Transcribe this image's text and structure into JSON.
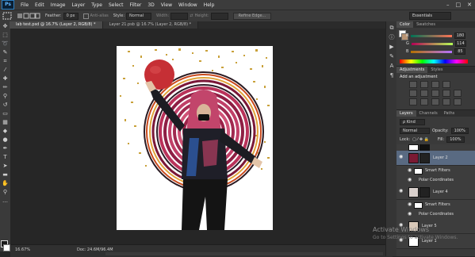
{
  "app": {
    "logo": "Ps"
  },
  "menu": [
    "File",
    "Edit",
    "Image",
    "Layer",
    "Type",
    "Select",
    "Filter",
    "3D",
    "View",
    "Window",
    "Help"
  ],
  "window_controls": [
    "–",
    "□",
    "✕"
  ],
  "options": {
    "feather_label": "Feather:",
    "feather_value": "0 px",
    "antialias_label": "Anti-alias",
    "style_label": "Style:",
    "style_value": "Normal",
    "width_label": "Width:",
    "height_label": "Height:",
    "refine_edge": "Refine Edge...",
    "workspace": "Essentials"
  },
  "tabs": [
    {
      "label": "lab test.psd @ 16.7% (Layer 2, RGB/8) *"
    },
    {
      "label": "Layer 21.psb @ 16.7% (Layer 2, RGB/8) *"
    }
  ],
  "status": {
    "zoom": "16.67%",
    "doc": "Doc: 24.6M/96.4M"
  },
  "color_panel": {
    "tab_color": "Color",
    "tab_swatches": "Swatches",
    "r_label": "R",
    "r_value": "180",
    "g_label": "G",
    "g_value": "114",
    "b_label": "B",
    "b_value": "85"
  },
  "adjustments": {
    "tab_adjustments": "Adjustments",
    "tab_styles": "Styles",
    "title": "Add an adjustment"
  },
  "layers": {
    "tab_layers": "Layers",
    "tab_channels": "Channels",
    "tab_paths": "Paths",
    "kind_label": "ρ Kind",
    "blend": "Normal",
    "opacity_label": "Opacity:",
    "opacity_value": "100%",
    "lock_label": "Lock:",
    "fill_label": "Fill:",
    "fill_value": "100%",
    "items": [
      {
        "name": "Layer 2"
      },
      {
        "name": "Smart Filters"
      },
      {
        "name": "Polar Coordinates"
      },
      {
        "name": "Layer 4"
      },
      {
        "name": "Smart Filters"
      },
      {
        "name": "Polar Coordinates"
      },
      {
        "name": "Layer 5"
      },
      {
        "name": "Layer 1"
      }
    ]
  },
  "watermark": {
    "line1": "Activate Windows",
    "line2": "Go to Settings to activate Windows."
  }
}
